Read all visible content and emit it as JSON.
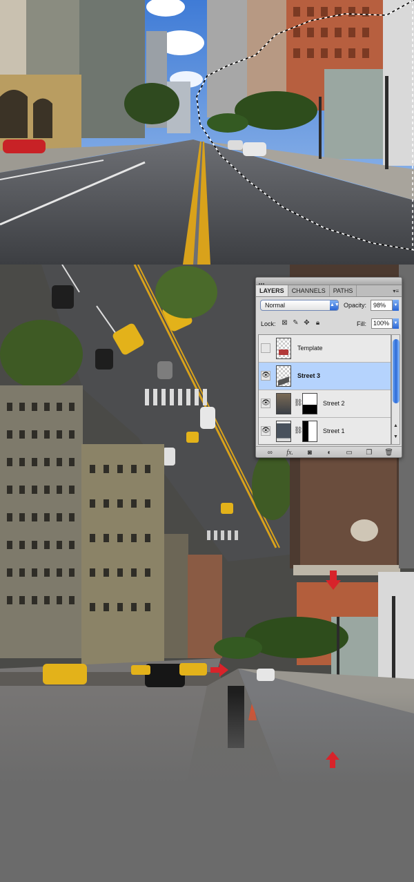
{
  "panel": {
    "tabs": [
      {
        "label": "LAYERS",
        "active": true
      },
      {
        "label": "CHANNELS",
        "active": false
      },
      {
        "label": "PATHS",
        "active": false
      }
    ],
    "blend_mode": "Normal",
    "opacity_label": "Opacity:",
    "opacity_value": "98%",
    "lock_label": "Lock:",
    "fill_label": "Fill:",
    "fill_value": "100%",
    "layers": [
      {
        "name": "Template",
        "visible": false,
        "selected": false,
        "has_mask": false
      },
      {
        "name": "Street 3",
        "visible": true,
        "selected": true,
        "has_mask": false
      },
      {
        "name": "Street 2",
        "visible": true,
        "selected": false,
        "has_mask": true
      },
      {
        "name": "Street 1",
        "visible": true,
        "selected": false,
        "has_mask": true
      }
    ],
    "bottom_icons": [
      "link-icon",
      "fx-icon",
      "mask-icon",
      "adjustment-icon",
      "group-folder-icon",
      "new-layer-icon",
      "trash-icon"
    ]
  },
  "colors": {
    "selection_highlight": "#b5d3fd",
    "scroll_accent": "#2c6ad7",
    "arrow_red": "#d8232a",
    "sky": "#5b8fd8",
    "taxi": "#e3b21a"
  },
  "annotations": [
    {
      "icon": "red-arrow-down-icon"
    },
    {
      "icon": "red-arrow-right-icon"
    },
    {
      "icon": "red-arrow-up-icon"
    }
  ]
}
